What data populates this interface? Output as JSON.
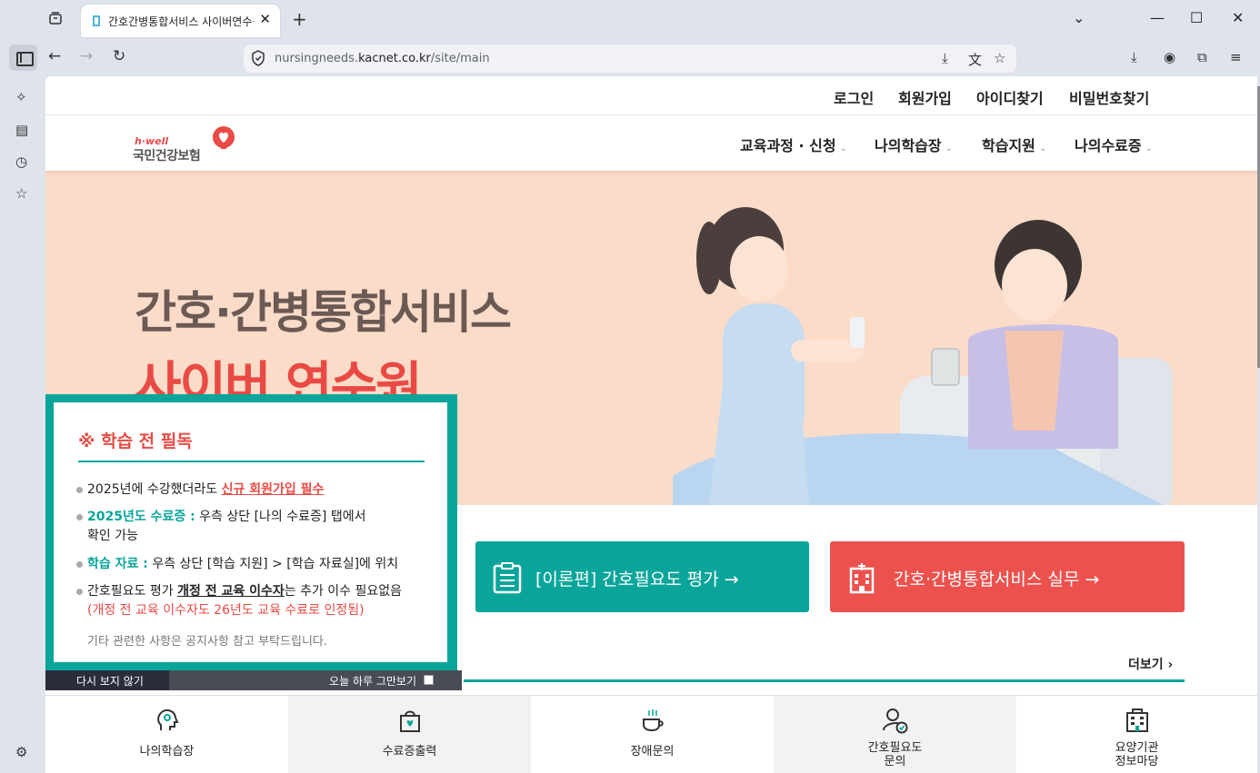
{
  "browser": {
    "tab_title": "간호간병통합서비스 사이버연수원",
    "url_host_prefix": "nursingneeds.",
    "url_domain": "kacnet.co.kr",
    "url_path": "/site/main"
  },
  "util_nav": {
    "login": "로그인",
    "signup": "회원가입",
    "find_id": "아이디찾기",
    "find_pw": "비밀번호찾기"
  },
  "logo": {
    "tagline": "h·well",
    "org": "국민건강보험"
  },
  "gnb": [
    {
      "label": "교육과정 · 신청"
    },
    {
      "label": "나의학습장"
    },
    {
      "label": "학습지원"
    },
    {
      "label": "나의수료증"
    }
  ],
  "hero": {
    "title_line1": "간호·간병통합서비스",
    "title_line2": "사이버 연수원"
  },
  "cta": {
    "theory": "[이론편] 간호필요도 평가 →",
    "practice": "간호·간병통합서비스 실무 →"
  },
  "board": {
    "more": "더보기 ›"
  },
  "popup": {
    "title": "※ 학습 전 필독",
    "item1_text": "2025년에 수강했더라도 ",
    "item1_em": "신규 회원가입 필수",
    "item2_em": "2025년도 수료증 :",
    "item2_text": " 우측 상단 [나의 수료증] 탭에서",
    "item2_text2": "확인 가능",
    "item3_em": "학습 자료 :",
    "item3_text": " 우측 상단 [학습 지원] > [학습 자료실]에 위치",
    "item4_text": "간호필요도 평가 ",
    "item4_em": "개정 전 교육 이수자",
    "item4_text2": "는 추가 이수 필요없음",
    "item4_note": "(개정 전 교육 이수자도 26년도 교육 수료로 인정됨)",
    "footer_note": "기타 관련한 사항은 공지사항 참고 부탁드립니다.",
    "dont_show": "다시 보지 않기",
    "hide_today": "오늘 하루 그만보기"
  },
  "quick_menu": [
    {
      "label": "나의학습장"
    },
    {
      "label": "수료증출력"
    },
    {
      "label": "장애문의"
    },
    {
      "label_line1": "간호필요도",
      "label_line2": "문의"
    },
    {
      "label_line1": "요양기관",
      "label_line2": "정보마당"
    }
  ],
  "colors": {
    "teal": "#0aa59a",
    "red": "#ec514d",
    "hero_bg": "#fbdcc9"
  }
}
